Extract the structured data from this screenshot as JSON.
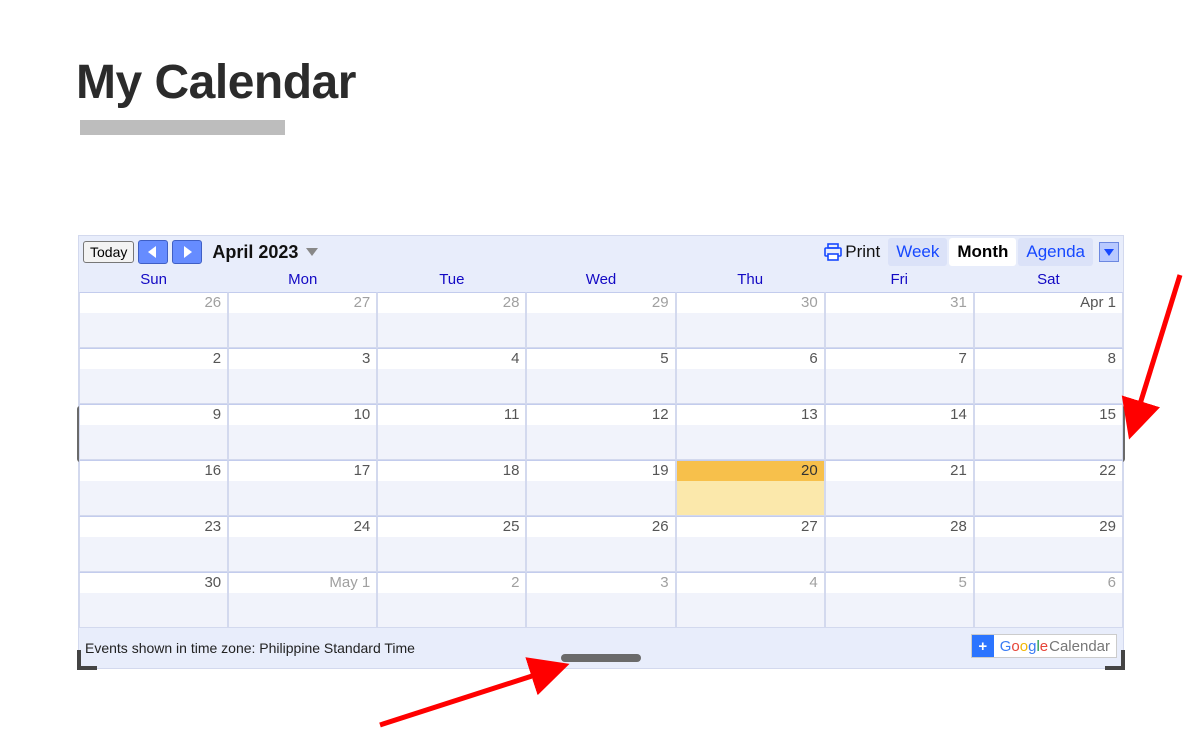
{
  "title": "My Calendar",
  "toolbar": {
    "today": "Today",
    "month_label": "April 2023",
    "print": "Print",
    "views": {
      "week": "Week",
      "month": "Month",
      "agenda": "Agenda"
    }
  },
  "dow": [
    "Sun",
    "Mon",
    "Tue",
    "Wed",
    "Thu",
    "Fri",
    "Sat"
  ],
  "weeks": [
    [
      {
        "n": "26",
        "dim": true
      },
      {
        "n": "27",
        "dim": true
      },
      {
        "n": "28",
        "dim": true
      },
      {
        "n": "29",
        "dim": true
      },
      {
        "n": "30",
        "dim": true
      },
      {
        "n": "31",
        "dim": true
      },
      {
        "n": "Apr 1"
      }
    ],
    [
      {
        "n": "2"
      },
      {
        "n": "3"
      },
      {
        "n": "4"
      },
      {
        "n": "5"
      },
      {
        "n": "6"
      },
      {
        "n": "7"
      },
      {
        "n": "8"
      }
    ],
    [
      {
        "n": "9"
      },
      {
        "n": "10"
      },
      {
        "n": "11"
      },
      {
        "n": "12"
      },
      {
        "n": "13"
      },
      {
        "n": "14"
      },
      {
        "n": "15"
      }
    ],
    [
      {
        "n": "16"
      },
      {
        "n": "17"
      },
      {
        "n": "18"
      },
      {
        "n": "19"
      },
      {
        "n": "20",
        "today": true
      },
      {
        "n": "21"
      },
      {
        "n": "22"
      }
    ],
    [
      {
        "n": "23"
      },
      {
        "n": "24"
      },
      {
        "n": "25"
      },
      {
        "n": "26"
      },
      {
        "n": "27"
      },
      {
        "n": "28"
      },
      {
        "n": "29"
      }
    ],
    [
      {
        "n": "30"
      },
      {
        "n": "May 1",
        "dim": true
      },
      {
        "n": "2",
        "dim": true
      },
      {
        "n": "3",
        "dim": true
      },
      {
        "n": "4",
        "dim": true
      },
      {
        "n": "5",
        "dim": true
      },
      {
        "n": "6",
        "dim": true
      }
    ]
  ],
  "footer": {
    "timezone_text": "Events shown in time zone: Philippine Standard Time",
    "google": "Google",
    "calendar": "Calendar"
  }
}
